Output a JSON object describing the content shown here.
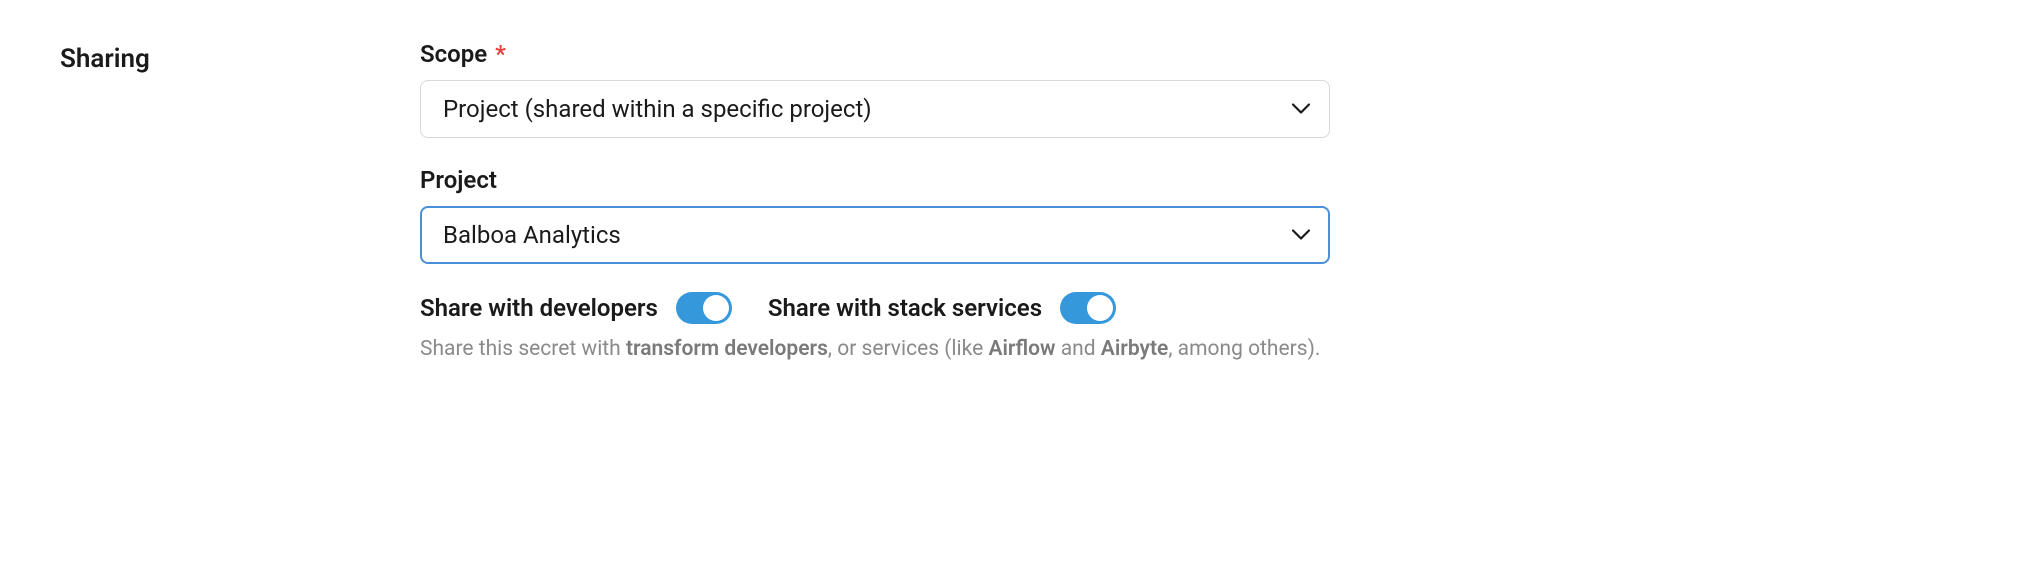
{
  "section": {
    "title": "Sharing"
  },
  "scope": {
    "label": "Scope",
    "required_marker": "*",
    "value": "Project (shared within a specific project)"
  },
  "project": {
    "label": "Project",
    "value": "Balboa Analytics"
  },
  "toggles": {
    "developers": {
      "label": "Share with developers",
      "on": true
    },
    "stack_services": {
      "label": "Share with stack services",
      "on": true
    }
  },
  "help": {
    "prefix": "Share this secret with ",
    "bold1": "transform developers",
    "mid": ", or services (like ",
    "bold2": "Airflow",
    "and": " and ",
    "bold3": "Airbyte",
    "suffix": ", among others)."
  }
}
